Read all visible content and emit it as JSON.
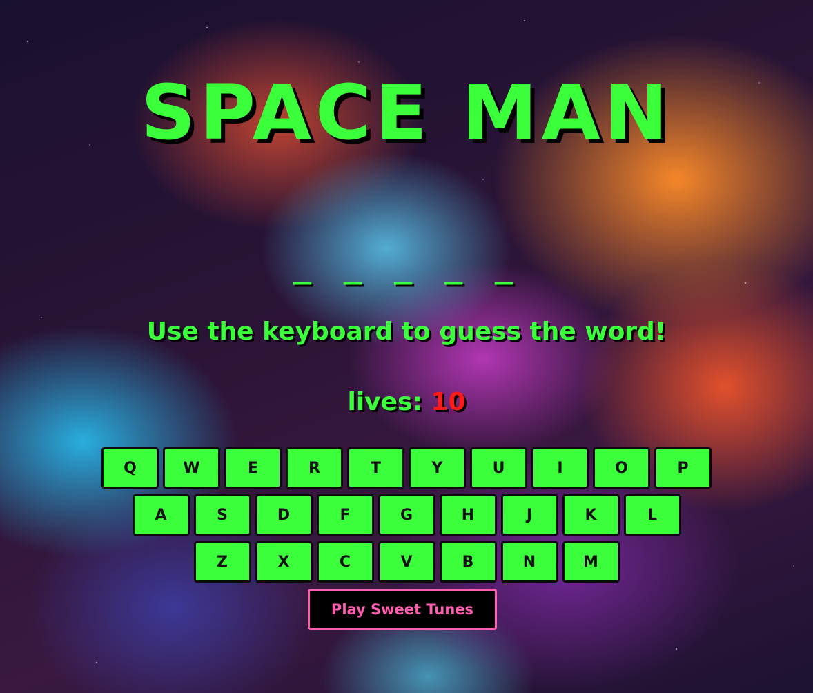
{
  "title": "SPACE MAN",
  "word_display": "_ _ _ _ _",
  "instructions": "Use the keyboard to guess the word!",
  "lives": {
    "label": "lives: ",
    "count": "10"
  },
  "keyboard": {
    "row1": [
      "Q",
      "W",
      "E",
      "R",
      "T",
      "Y",
      "U",
      "I",
      "O",
      "P"
    ],
    "row2": [
      "A",
      "S",
      "D",
      "F",
      "G",
      "H",
      "J",
      "K",
      "L"
    ],
    "row3": [
      "Z",
      "X",
      "C",
      "V",
      "B",
      "N",
      "M"
    ]
  },
  "music_button_label": "Play Sweet Tunes",
  "colors": {
    "accent_green": "#3cff3c",
    "lives_red": "#ff1a1a",
    "music_pink": "#ff5fb0"
  }
}
